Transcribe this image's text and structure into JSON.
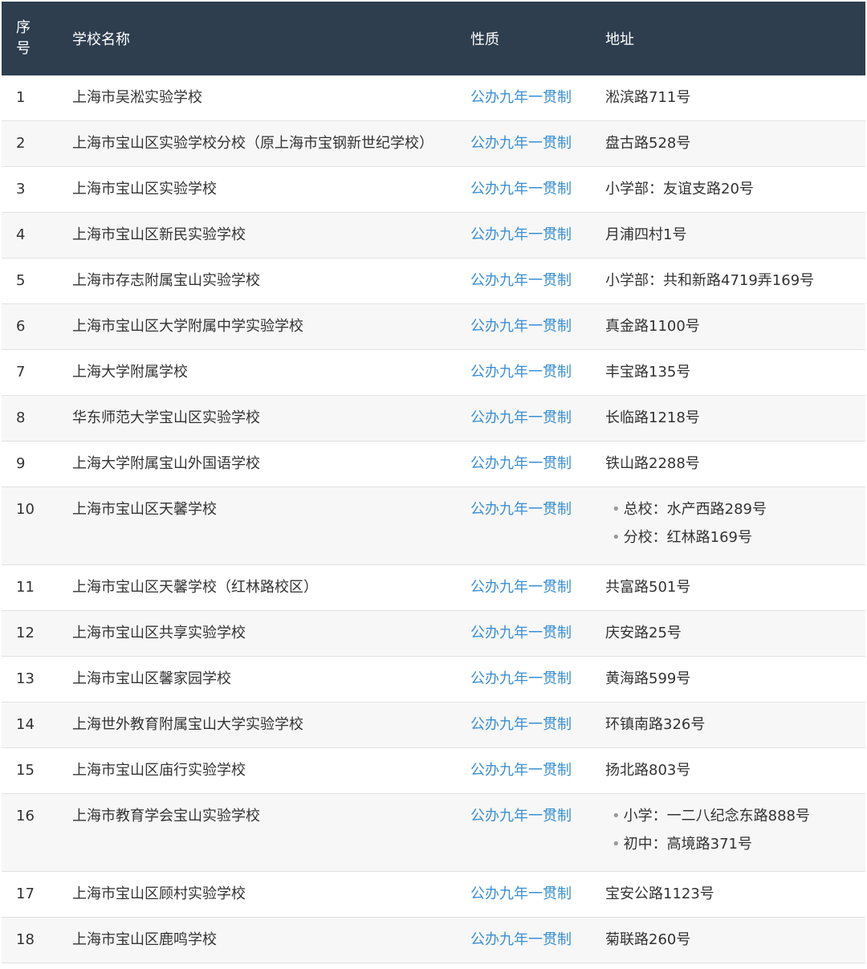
{
  "header": {
    "no": "序号",
    "name": "学校名称",
    "type": "性质",
    "address": "地址"
  },
  "rows": [
    {
      "no": "1",
      "name": "上海市吴淞实验学校",
      "type": "公办九年一贯制",
      "address": "淞滨路711号"
    },
    {
      "no": "2",
      "name": "上海市宝山区实验学校分校（原上海市宝钢新世纪学校）",
      "type": "公办九年一贯制",
      "address": "盘古路528号"
    },
    {
      "no": "3",
      "name": "上海市宝山区实验学校",
      "type": "公办九年一贯制",
      "address": "小学部：友谊支路20号"
    },
    {
      "no": "4",
      "name": "上海市宝山区新民实验学校",
      "type": "公办九年一贯制",
      "address": "月浦四村1号"
    },
    {
      "no": "5",
      "name": "上海市存志附属宝山实验学校",
      "type": "公办九年一贯制",
      "address": "小学部：共和新路4719弄169号"
    },
    {
      "no": "6",
      "name": "上海市宝山区大学附属中学实验学校",
      "type": "公办九年一贯制",
      "address": "真金路1100号"
    },
    {
      "no": "7",
      "name": "上海大学附属学校",
      "type": "公办九年一贯制",
      "address": "丰宝路135号"
    },
    {
      "no": "8",
      "name": "华东师范大学宝山区实验学校",
      "type": "公办九年一贯制",
      "address": "长临路1218号"
    },
    {
      "no": "9",
      "name": "上海大学附属宝山外国语学校",
      "type": "公办九年一贯制",
      "address": "铁山路2288号"
    },
    {
      "no": "10",
      "name": "上海市宝山区天馨学校",
      "type": "公办九年一贯制",
      "address_list": [
        "总校：水产西路289号",
        "分校：红林路169号"
      ]
    },
    {
      "no": "11",
      "name": "上海市宝山区天馨学校（红林路校区）",
      "type": "公办九年一贯制",
      "address": "共富路501号"
    },
    {
      "no": "12",
      "name": "上海市宝山区共享实验学校",
      "type": "公办九年一贯制",
      "address": "庆安路25号"
    },
    {
      "no": "13",
      "name": "上海市宝山区馨家园学校",
      "type": "公办九年一贯制",
      "address": "黄海路599号"
    },
    {
      "no": "14",
      "name": "上海世外教育附属宝山大学实验学校",
      "type": "公办九年一贯制",
      "address": "环镇南路326号"
    },
    {
      "no": "15",
      "name": "上海市宝山区庙行实验学校",
      "type": "公办九年一贯制",
      "address": "扬北路803号"
    },
    {
      "no": "16",
      "name": "上海市教育学会宝山实验学校",
      "type": "公办九年一贯制",
      "address_list": [
        "小学：一二八纪念东路888号",
        "初中：高境路371号"
      ]
    },
    {
      "no": "17",
      "name": "上海市宝山区顾村实验学校",
      "type": "公办九年一贯制",
      "address": "宝安公路1123号"
    },
    {
      "no": "18",
      "name": "上海市宝山区鹿鸣学校",
      "type": "公办九年一贯制",
      "address": "菊联路260号"
    }
  ],
  "colors": {
    "header_bg": "#2e3e4f",
    "link": "#3a8fd4",
    "stripe": "#f7f7f7"
  }
}
